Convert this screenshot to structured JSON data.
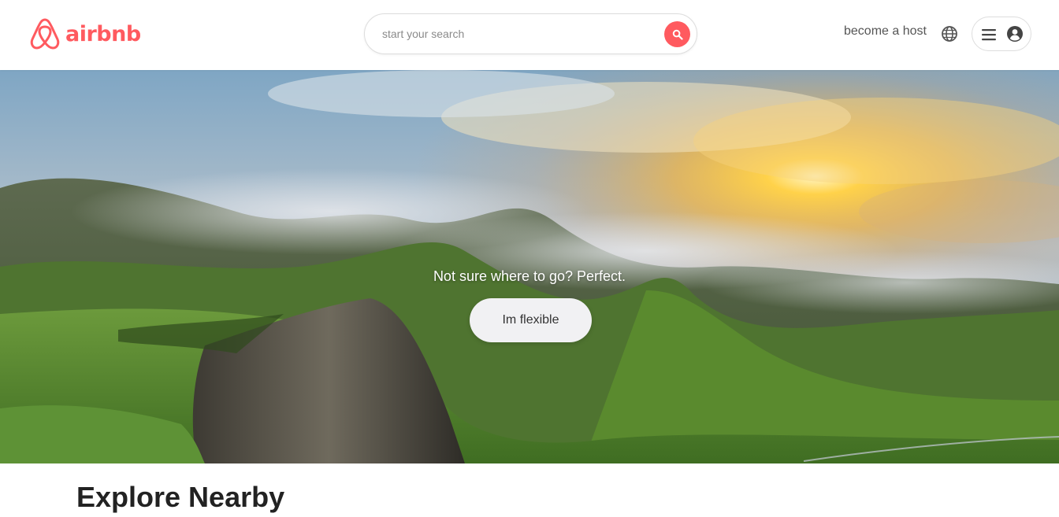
{
  "brand": {
    "name": "airbnb",
    "color": "#ff5a5f"
  },
  "header": {
    "search": {
      "placeholder": "start your search",
      "value": ""
    },
    "host_link": "become a host",
    "icons": [
      "search-icon",
      "globe-icon",
      "hamburger-icon",
      "user-circle-icon"
    ]
  },
  "hero": {
    "caption": "Not sure where to go? Perfect.",
    "button_label": "Im flexible"
  },
  "explore": {
    "title": "Explore Nearby"
  }
}
